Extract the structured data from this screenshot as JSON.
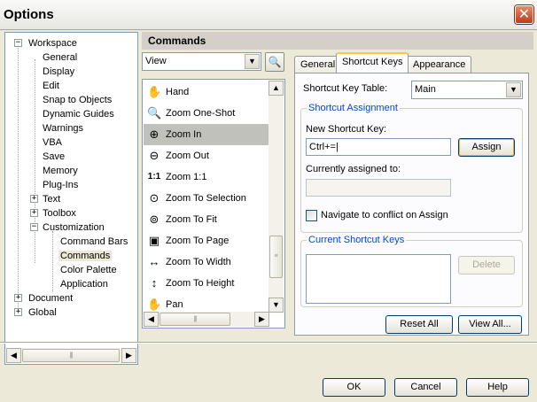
{
  "window": {
    "title": "Options",
    "close_glyph": "✕"
  },
  "tree": {
    "items": [
      {
        "label": "Workspace",
        "expander": "−"
      },
      {
        "label": "General"
      },
      {
        "label": "Display"
      },
      {
        "label": "Edit"
      },
      {
        "label": "Snap to Objects"
      },
      {
        "label": "Dynamic Guides"
      },
      {
        "label": "Warnings"
      },
      {
        "label": "VBA"
      },
      {
        "label": "Save"
      },
      {
        "label": "Memory"
      },
      {
        "label": "Plug-Ins"
      },
      {
        "label": "Text",
        "expander": "+"
      },
      {
        "label": "Toolbox",
        "expander": "+"
      },
      {
        "label": "Customization",
        "expander": "−"
      },
      {
        "label": "Command Bars"
      },
      {
        "label": "Commands",
        "selected": true
      },
      {
        "label": "Color Palette"
      },
      {
        "label": "Application"
      },
      {
        "label": "Document",
        "expander": "+"
      },
      {
        "label": "Global",
        "expander": "+"
      }
    ],
    "scroll_left": "◀",
    "scroll_right": "▶",
    "scroll_grip": "|||"
  },
  "section": {
    "title": "Commands"
  },
  "category": {
    "value": "View",
    "arrow": "▼",
    "find_icon": "🔍"
  },
  "commands": [
    {
      "label": "Hand",
      "icon": "hand-icon",
      "glyph": "✋"
    },
    {
      "label": "Zoom One-Shot",
      "icon": "zoom-one-shot-icon",
      "glyph": "🔍"
    },
    {
      "label": "Zoom In",
      "icon": "zoom-in-icon",
      "glyph": "⊕",
      "selected": true
    },
    {
      "label": "Zoom Out",
      "icon": "zoom-out-icon",
      "glyph": "⊖"
    },
    {
      "label": "Zoom 1:1",
      "icon": "zoom-1-1-icon",
      "glyph": "1:1"
    },
    {
      "label": "Zoom To Selection",
      "icon": "zoom-to-selection-icon",
      "glyph": "⊙"
    },
    {
      "label": "Zoom To Fit",
      "icon": "zoom-to-fit-icon",
      "glyph": "⊚"
    },
    {
      "label": "Zoom To Page",
      "icon": "zoom-to-page-icon",
      "glyph": "▣"
    },
    {
      "label": "Zoom To Width",
      "icon": "zoom-to-width-icon",
      "glyph": "↔"
    },
    {
      "label": "Zoom To Height",
      "icon": "zoom-to-height-icon",
      "glyph": "↕"
    },
    {
      "label": "Pan",
      "icon": "pan-icon",
      "glyph": "✋"
    }
  ],
  "command_scroll": {
    "up": "▲",
    "down": "▼",
    "left": "◀",
    "right": "▶",
    "grip": "≡"
  },
  "tabs": [
    {
      "label": "General"
    },
    {
      "label": "Shortcut Keys",
      "active": true
    },
    {
      "label": "Appearance"
    }
  ],
  "shortcut": {
    "table_label": "Shortcut Key Table:",
    "table_value": "Main",
    "assignment_group": "Shortcut Assignment",
    "new_key_label": "New Shortcut Key:",
    "new_key_value": "Ctrl+=|",
    "assign_button": "Assign",
    "currently_assigned_label": "Currently assigned to:",
    "currently_assigned_value": "",
    "navigate_checkbox": "Navigate to conflict on Assign",
    "navigate_checked": false,
    "current_group": "Current Shortcut Keys",
    "delete_button": "Delete",
    "reset_all_button": "Reset All",
    "view_all_button": "View All..."
  },
  "footer": {
    "ok": "OK",
    "cancel": "Cancel",
    "help": "Help"
  }
}
